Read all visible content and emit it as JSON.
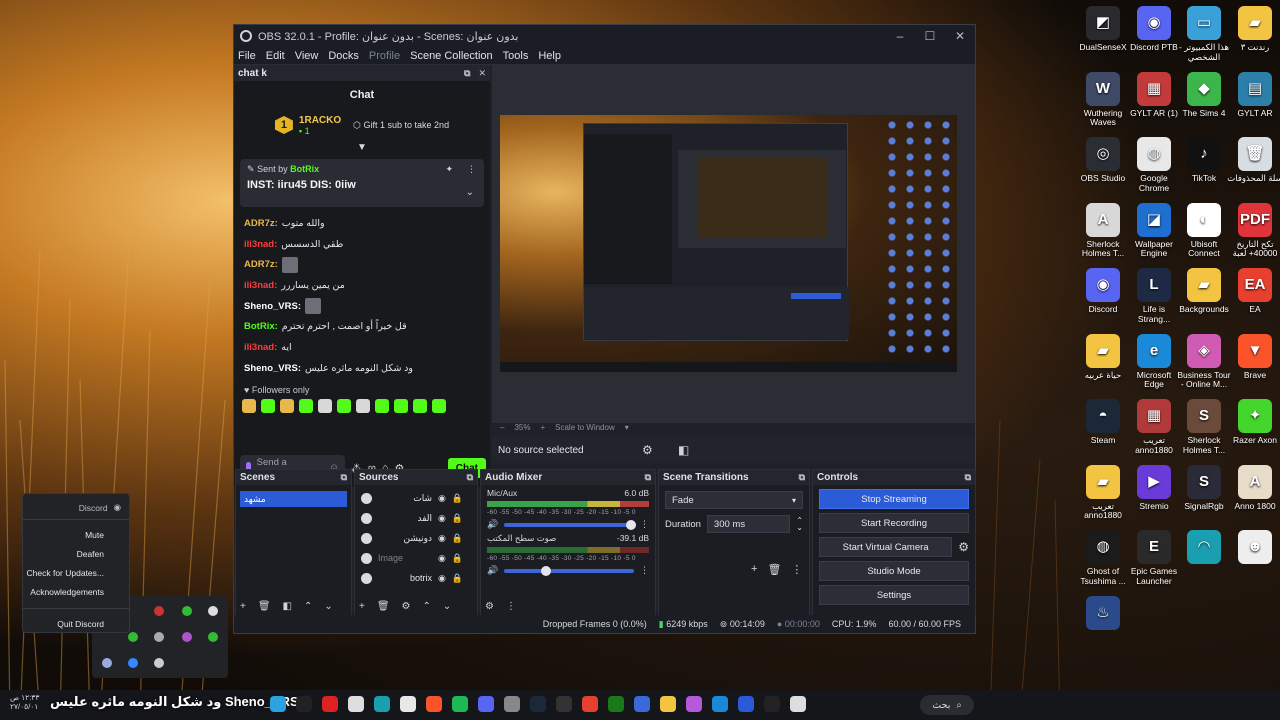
{
  "obs": {
    "title": "OBS 32.0.1 - Profile: بدون عنوان - Scenes: بدون عنوان",
    "menu": [
      "File",
      "Edit",
      "View",
      "Docks",
      "Profile",
      "Scene Collection",
      "Tools",
      "Help"
    ],
    "chat_dock": {
      "dock_title": "chat k",
      "chat_heading": "Chat",
      "top_gifter": {
        "rank": "1",
        "name": "1RACKO",
        "subs": "1",
        "gift_prompt": "Gift 1 sub to take 2nd"
      },
      "pinned": {
        "sent_by_label": "Sent by",
        "sent_by_user": "BotRix",
        "text": "INST: iiru45 DIS: 0iiw"
      },
      "messages": [
        {
          "user": "ADR7z:",
          "color": "#e9b84a",
          "text": "والله متوب"
        },
        {
          "user": "ili3nad:",
          "color": "#ff3b3b",
          "text": "طقي الدسسس"
        },
        {
          "user": "ADR7z:",
          "color": "#e9b84a",
          "text": ""
        },
        {
          "user": "ili3nad:",
          "color": "#ff3b3b",
          "text": "من يمين يساررر"
        },
        {
          "user": "Sheno_VRS:",
          "color": "#ffffff",
          "text": ""
        },
        {
          "user": "BotRix:",
          "color": "#53fc18",
          "text": "قل خيراً أو اصمت , احترم تحترم"
        },
        {
          "user": "ili3nad:",
          "color": "#ff3b3b",
          "text": "ايه"
        },
        {
          "user": "Sheno_VRS:",
          "color": "#ffffff",
          "text": "ود شكل النومه ماثره عليس"
        }
      ],
      "followers_only": "Followers only",
      "input_placeholder": "Send a message",
      "send_label": "Chat"
    },
    "preview": {
      "zoom": "35%",
      "scale_mode": "Scale to Window",
      "no_source": "No source selected"
    },
    "scenes": {
      "title": "Scenes",
      "items": [
        "مشهد"
      ]
    },
    "sources": {
      "title": "Sources",
      "items": [
        {
          "name": "شات",
          "dim": false
        },
        {
          "name": "الفد",
          "dim": false
        },
        {
          "name": "دونيشن",
          "dim": false
        },
        {
          "name": "Image",
          "dim": true
        },
        {
          "name": "botrix",
          "dim": false
        }
      ]
    },
    "audio_mixer": {
      "title": "Audio Mixer",
      "channels": [
        {
          "name": "Mic/Aux",
          "db": "6.0 dB",
          "fader": 0.98
        },
        {
          "name": "صوت سطح المكتب",
          "db": "-39.1 dB",
          "fader": 0.32
        }
      ],
      "scale": "-60 -55 -50 -45 -40 -35 -30 -25 -20 -15 -10 -5 0"
    },
    "transitions": {
      "title": "Scene Transitions",
      "selected": "Fade",
      "duration_label": "Duration",
      "duration_value": "300 ms"
    },
    "controls": {
      "title": "Controls",
      "stop_streaming": "Stop Streaming",
      "start_recording": "Start Recording",
      "start_virtual_camera": "Start Virtual Camera",
      "studio_mode": "Studio Mode",
      "settings": "Settings"
    },
    "status": {
      "dropped": "Dropped Frames 0 (0.0%)",
      "bitrate": "6249 kbps",
      "stream_time": "00:14:09",
      "rec_time": "00:00:00",
      "cpu": "CPU: 1.9%",
      "fps": "60.00 / 60.00 FPS"
    }
  },
  "desktop_icons": [
    {
      "label": "DualSenseX",
      "color": "#2a2a2e",
      "glyph": "◩"
    },
    {
      "label": "Discord PTB",
      "color": "#5865f2",
      "glyph": "◉"
    },
    {
      "label": "هذا الكمبيوتر - الشخصي",
      "color": "#3aa0d8",
      "glyph": "▭"
    },
    {
      "label": "رندنت ٣",
      "color": "#f3c342",
      "glyph": "▰"
    },
    {
      "label": "Wuthering Waves",
      "color": "#3e4a66",
      "glyph": "W"
    },
    {
      "label": "GYLT AR (1)",
      "color": "#c23a3a",
      "glyph": "▦"
    },
    {
      "label": "The Sims 4",
      "color": "#3cb64a",
      "glyph": "◆"
    },
    {
      "label": "GYLT AR",
      "color": "#2c7fa8",
      "glyph": "▤"
    },
    {
      "label": "OBS Studio",
      "color": "#2b2d34",
      "glyph": "◎"
    },
    {
      "label": "Google Chrome",
      "color": "#e8e8e8",
      "glyph": "◍"
    },
    {
      "label": "TikTok",
      "color": "#111111",
      "glyph": "♪"
    },
    {
      "label": "سلة المحذوفات",
      "color": "#d8dde4",
      "glyph": "🗑"
    },
    {
      "label": "Sherlock Holmes T...",
      "color": "#d8d8d8",
      "glyph": "A"
    },
    {
      "label": "Wallpaper Engine",
      "color": "#1f6fd0",
      "glyph": "◪"
    },
    {
      "label": "Ubisoft Connect",
      "color": "#ffffff",
      "glyph": "◐"
    },
    {
      "label": "تكح التاريخ 40000+ لعبة",
      "color": "#e0343a",
      "glyph": "PDF"
    },
    {
      "label": "Discord",
      "color": "#5865f2",
      "glyph": "◉"
    },
    {
      "label": "Life is Strang...",
      "color": "#1e2a44",
      "glyph": "L"
    },
    {
      "label": "Backgrounds",
      "color": "#f3c342",
      "glyph": "▰"
    },
    {
      "label": "EA",
      "color": "#e8402e",
      "glyph": "EA"
    },
    {
      "label": "حياة عربيه",
      "color": "#f3c342",
      "glyph": "▰"
    },
    {
      "label": "Microsoft Edge",
      "color": "#1a8ad8",
      "glyph": "e"
    },
    {
      "label": "Business Tour - Online M...",
      "color": "#d05bb3",
      "glyph": "◈"
    },
    {
      "label": "Brave",
      "color": "#fb542b",
      "glyph": "▼"
    },
    {
      "label": "Steam",
      "color": "#1b2838",
      "glyph": "◓"
    },
    {
      "label": "تعريب anno1880",
      "color": "#b03a3a",
      "glyph": "▦"
    },
    {
      "label": "Sherlock Holmes T...",
      "color": "#6a4a3a",
      "glyph": "S"
    },
    {
      "label": "Razer Axon",
      "color": "#44d62c",
      "glyph": "✦"
    },
    {
      "label": "تعريب anno1880",
      "color": "#f3c342",
      "glyph": "▰"
    },
    {
      "label": "Stremio",
      "color": "#6a3bd8",
      "glyph": "▶"
    },
    {
      "label": "SignalRgb",
      "color": "#2a2a38",
      "glyph": "S"
    },
    {
      "label": "Anno 1800",
      "color": "#e6dcc8",
      "glyph": "A"
    },
    {
      "label": "Ghost of Tsushima ...",
      "color": "#1b1b1b",
      "glyph": "◍"
    },
    {
      "label": "Epic Games Launcher",
      "color": "#2a2a2a",
      "glyph": "E"
    },
    {
      "label": "",
      "color": "#1a9fb0",
      "glyph": "◠"
    },
    {
      "label": "",
      "color": "#eeeeee",
      "glyph": "☻"
    },
    {
      "label": "",
      "color": "#2a4a8a",
      "glyph": "♨"
    }
  ],
  "tray_menu": {
    "header": "Discord",
    "items": [
      "Mute",
      "Deafen",
      "Check for Updates...",
      "Acknowledgements"
    ],
    "quit": "Quit Discord"
  },
  "taskbar": {
    "time": "١٢:٣٣ ص",
    "date": "٢٧/٠٥/٠١",
    "ticker": "ود شكل النومه ماثره عليس Sheno_VRS",
    "search": "بحث"
  }
}
